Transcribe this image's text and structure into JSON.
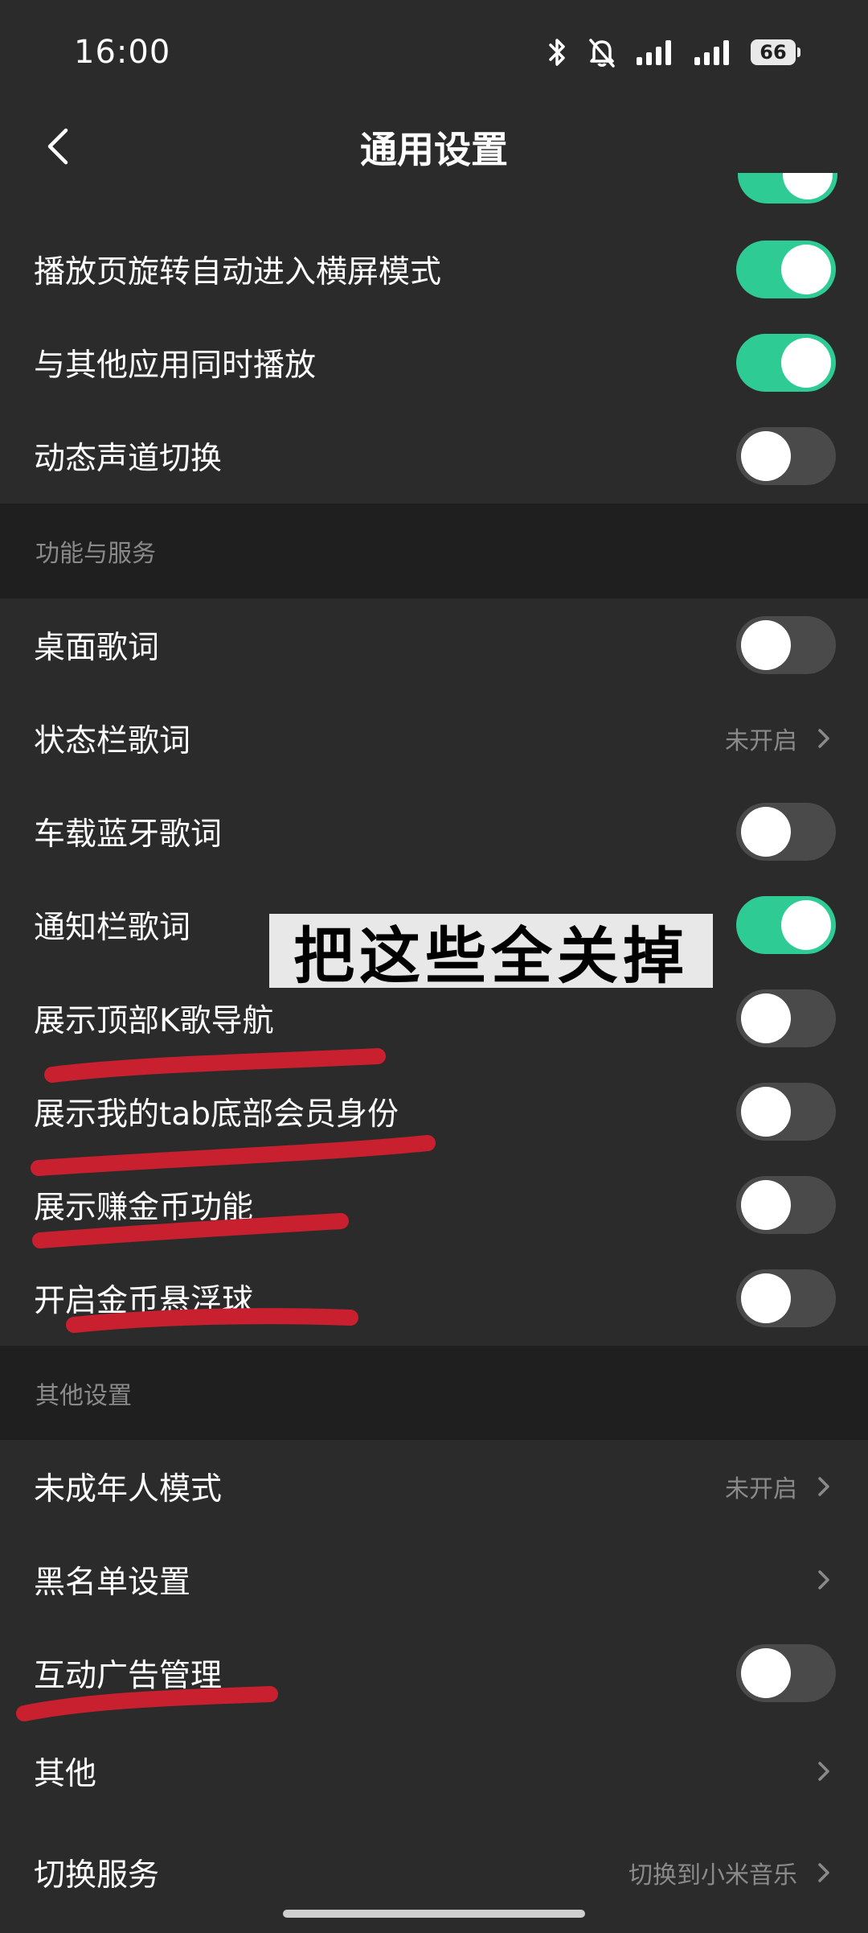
{
  "status_bar": {
    "time": "16:00",
    "battery": "66",
    "icons": [
      "bluetooth-icon",
      "mute-bell-icon",
      "signal-icon",
      "signal-icon",
      "battery-icon"
    ]
  },
  "nav": {
    "title": "通用设置",
    "back_icon": "back-chevron-icon"
  },
  "rows_top": [
    {
      "label": "播放页旋转自动进入横屏模式",
      "toggle": true
    },
    {
      "label": "与其他应用同时播放",
      "toggle": true
    },
    {
      "label": "动态声道切换",
      "toggle": false
    }
  ],
  "section_features": {
    "header": "功能与服务",
    "rows": [
      {
        "label": "桌面歌词",
        "toggle": false
      },
      {
        "label": "状态栏歌词",
        "value": "未开启"
      },
      {
        "label": "车载蓝牙歌词",
        "toggle": false
      },
      {
        "label": "通知栏歌词",
        "toggle": true
      },
      {
        "label": "展示顶部K歌导航",
        "toggle": false
      },
      {
        "label": "展示我的tab底部会员身份",
        "toggle": false
      },
      {
        "label": "展示赚金币功能",
        "toggle": false
      },
      {
        "label": "开启金币悬浮球",
        "toggle": false
      }
    ]
  },
  "section_other": {
    "header": "其他设置",
    "rows": [
      {
        "label": "未成年人模式",
        "value": "未开启"
      },
      {
        "label": "黑名单设置"
      },
      {
        "label": "互动广告管理",
        "toggle": false
      },
      {
        "label": "其他"
      },
      {
        "label": "切换服务",
        "value": "切换到小米音乐"
      }
    ]
  },
  "annotation": {
    "banner_text": "把这些全关掉",
    "underline_color": "#c8202e"
  },
  "colors": {
    "toggle_on": "#2ecc94",
    "toggle_off": "#4a4a4a",
    "background": "#2b2b2b",
    "section_bg": "#1f1f1f"
  }
}
